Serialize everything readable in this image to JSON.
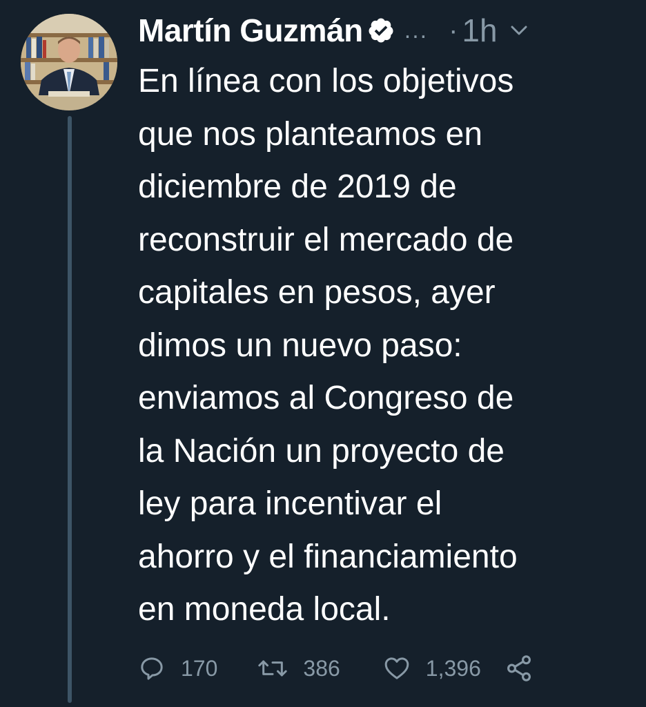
{
  "tweet": {
    "author_name": "Martín Guzmán",
    "more_indicator": "...",
    "separator": "·",
    "time": "1h",
    "text_lines": [
      "En línea con los objetivos",
      "que nos planteamos en",
      "diciembre de 2019 de",
      "reconstruir el mercado de",
      "capitales en pesos, ayer",
      "dimos un nuevo paso:",
      "enviamos al Congreso de",
      "la Nación un proyecto de",
      "ley para incentivar el",
      "ahorro y el financiamiento",
      "en moneda local."
    ],
    "replies": "170",
    "retweets": "386",
    "likes": "1,396"
  },
  "icons": {
    "verified": "verified-badge-icon",
    "caret": "chevron-down-icon",
    "reply": "reply-icon",
    "retweet": "retweet-icon",
    "like": "heart-icon",
    "share": "share-icon"
  },
  "colors": {
    "background": "#15202b",
    "text": "#ffffff",
    "secondary": "#8899a6",
    "thread_line": "#3d5466"
  }
}
